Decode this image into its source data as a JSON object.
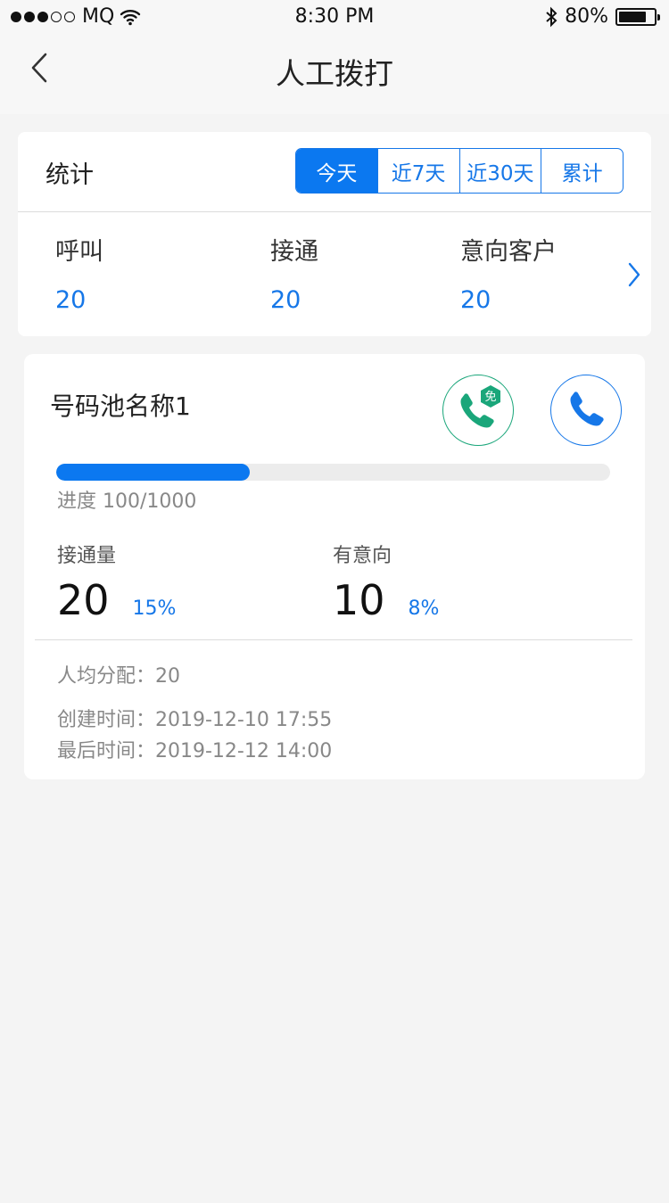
{
  "status_bar": {
    "carrier": "MQ",
    "time": "8:30 PM",
    "battery": "80%",
    "battery_level": 0.8
  },
  "nav": {
    "title": "人工拨打"
  },
  "stats": {
    "title": "统计",
    "tabs": [
      {
        "label": "今天",
        "active": true
      },
      {
        "label": "近7天",
        "active": false
      },
      {
        "label": "近30天",
        "active": false
      },
      {
        "label": "累计",
        "active": false
      }
    ],
    "metrics": [
      {
        "label": "呼叫",
        "value": "20"
      },
      {
        "label": "接通",
        "value": "20"
      },
      {
        "label": "意向客户",
        "value": "20"
      }
    ]
  },
  "pool": {
    "name": "号码池名称1",
    "free_badge": "免",
    "progress_text": "进度 100/1000",
    "progress_fraction": 0.35,
    "connected": {
      "label": "接通量",
      "value": "20",
      "percent": "15%"
    },
    "intent": {
      "label": "有意向",
      "value": "10",
      "percent": "8%"
    },
    "avg_alloc": "人均分配：20",
    "created": "创建时间：2019-12-10 17:55",
    "last": "最后时间：2019-12-12 14:00"
  },
  "colors": {
    "accent": "#0b78f0",
    "green": "#1aa67a",
    "background": "#f4f4f4"
  }
}
